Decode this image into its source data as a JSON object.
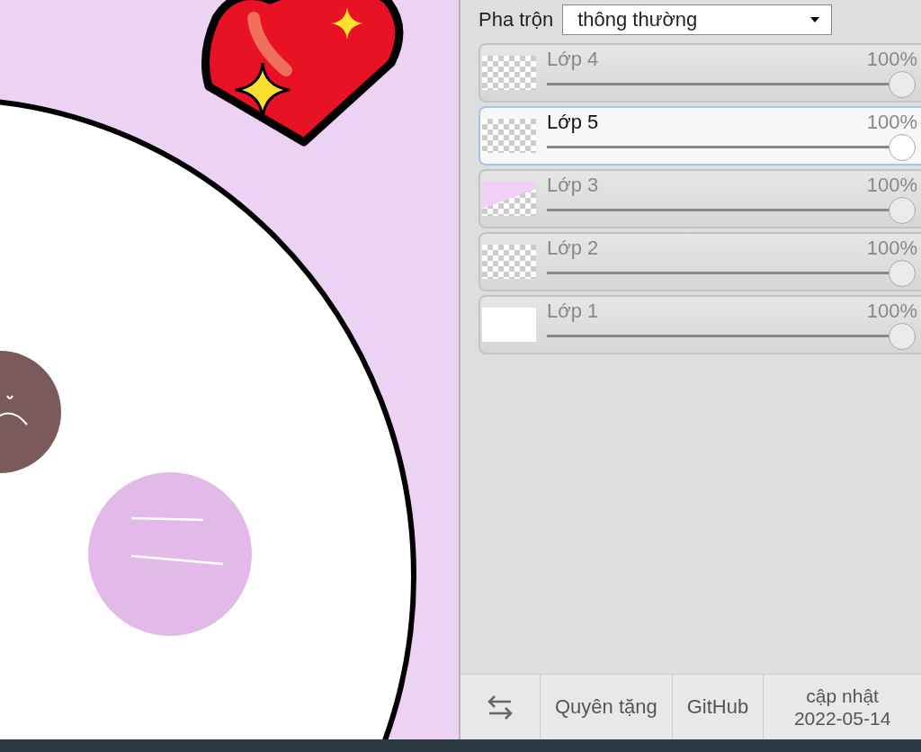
{
  "blend": {
    "label": "Pha trộn",
    "value": "thông thường"
  },
  "layers": [
    {
      "name": "Lớp 4",
      "opacity": "100%",
      "level": 1,
      "selected": false,
      "kind": "transparent"
    },
    {
      "name": "Lớp 5",
      "opacity": "100%",
      "level": 1,
      "selected": true,
      "kind": "transparent"
    },
    {
      "name": "Lớp 3",
      "opacity": "100%",
      "level": 1,
      "selected": false,
      "kind": "tinted"
    },
    {
      "name": "Lớp 2",
      "opacity": "100%",
      "level": 1,
      "selected": false,
      "kind": "transparent"
    },
    {
      "name": "Lớp 1",
      "opacity": "100%",
      "level": 1,
      "selected": false,
      "kind": "opaque"
    }
  ],
  "footer": {
    "donate": "Quyên tặng",
    "github": "GitHub",
    "update_label": "cập nhật",
    "update_date": "2022-05-14"
  }
}
